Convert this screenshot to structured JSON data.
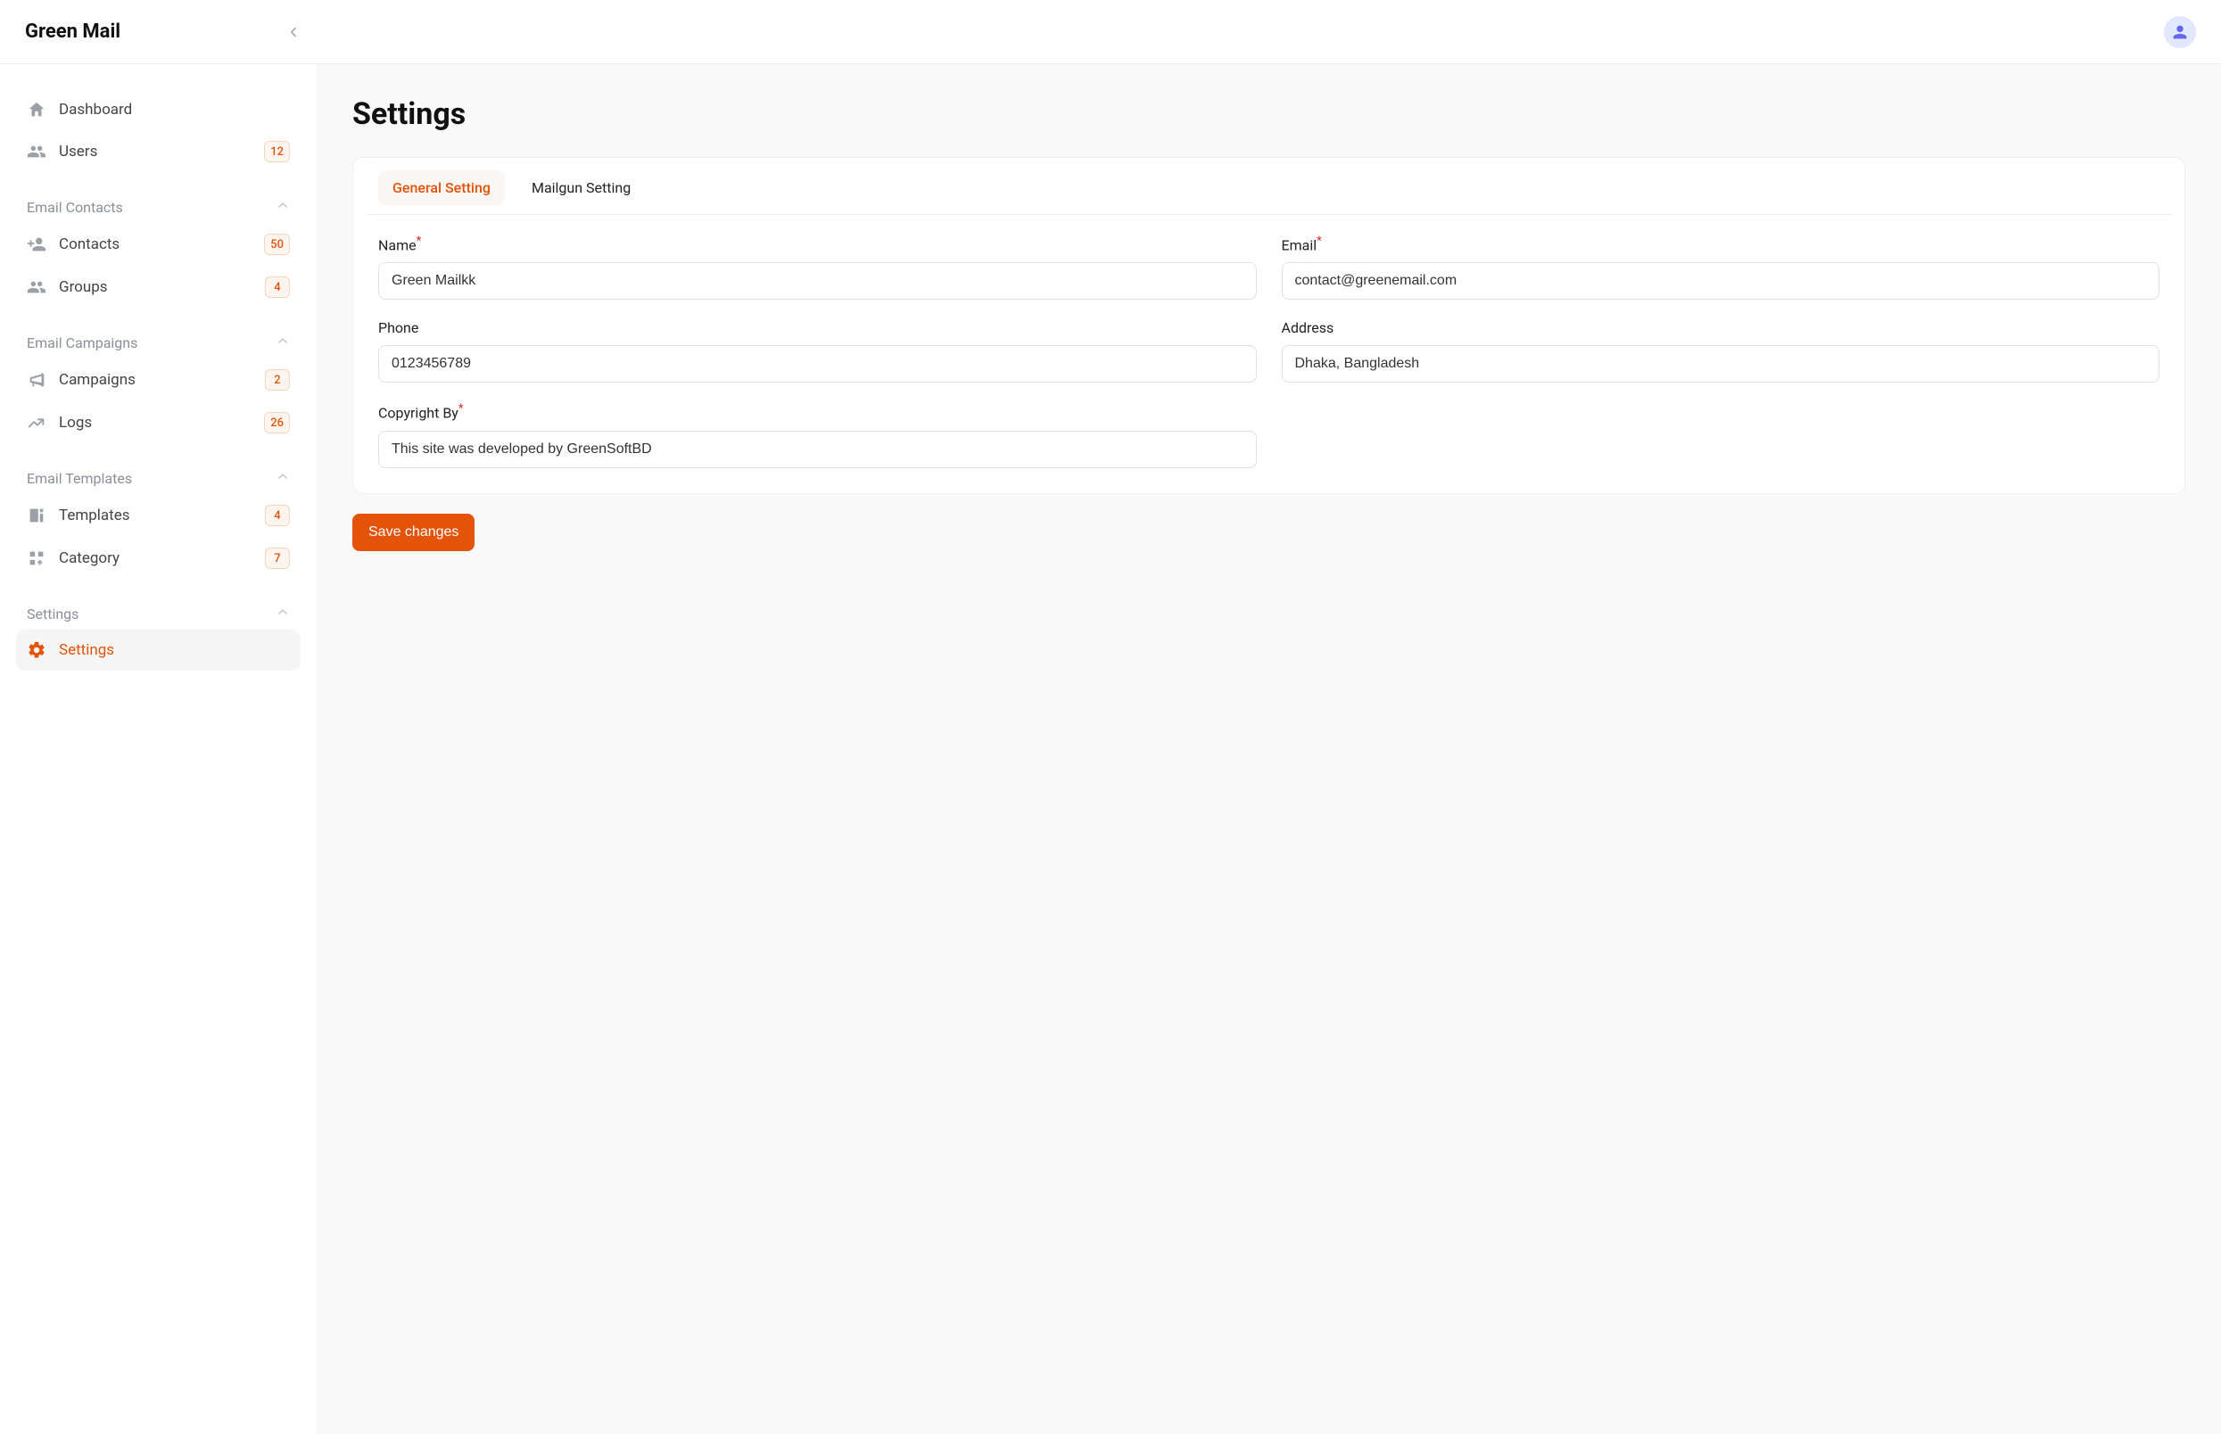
{
  "brand": "Green Mail",
  "sidebar": {
    "top_items": [
      {
        "label": "Dashboard",
        "badge": null,
        "icon": "home"
      },
      {
        "label": "Users",
        "badge": "12",
        "icon": "users"
      }
    ],
    "sections": [
      {
        "title": "Email Contacts",
        "items": [
          {
            "label": "Contacts",
            "badge": "50",
            "icon": "user-plus"
          },
          {
            "label": "Groups",
            "badge": "4",
            "icon": "users"
          }
        ]
      },
      {
        "title": "Email Campaigns",
        "items": [
          {
            "label": "Campaigns",
            "badge": "2",
            "icon": "bullhorn"
          },
          {
            "label": "Logs",
            "badge": "26",
            "icon": "trend"
          }
        ]
      },
      {
        "title": "Email Templates",
        "items": [
          {
            "label": "Templates",
            "badge": "4",
            "icon": "template"
          },
          {
            "label": "Category",
            "badge": "7",
            "icon": "grid-plus"
          }
        ]
      },
      {
        "title": "Settings",
        "items": [
          {
            "label": "Settings",
            "badge": null,
            "icon": "gear",
            "active": true
          }
        ]
      }
    ]
  },
  "page": {
    "title": "Settings",
    "tabs": [
      {
        "label": "General Setting",
        "active": true
      },
      {
        "label": "Mailgun Setting",
        "active": false
      }
    ],
    "fields": {
      "name": {
        "label": "Name",
        "value": "Green Mailkk",
        "required": true
      },
      "email": {
        "label": "Email",
        "value": "contact@greenemail.com",
        "required": true
      },
      "phone": {
        "label": "Phone",
        "value": "0123456789",
        "required": false
      },
      "address": {
        "label": "Address",
        "value": "Dhaka, Bangladesh",
        "required": false
      },
      "copyright": {
        "label": "Copyright By",
        "value": "This site was developed by GreenSoftBD",
        "required": true
      }
    },
    "save_label": "Save changes"
  }
}
